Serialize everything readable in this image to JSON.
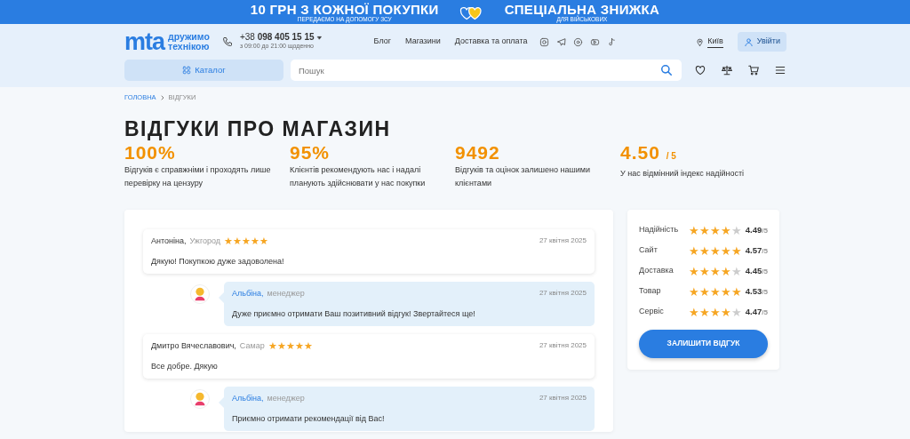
{
  "promo_banner": {
    "left_title": "10 ГРН З КОЖНОЇ ПОКУПКИ",
    "left_subtitle": "ПЕРЕДАЄМО НА ДОПОМОГУ ЗСУ",
    "right_title": "СПЕЦІАЛЬНА ЗНИЖКА",
    "right_subtitle": "ДЛЯ ВІЙСЬКОВИХ"
  },
  "header": {
    "logo": {
      "mark": "mta",
      "tagline": [
        "дружимо",
        "технікою"
      ]
    },
    "phone": {
      "prefix": "+38",
      "number": "098 405 15 15",
      "hours": "з 09:00 до 21:00 щоденно"
    },
    "nav_links": [
      "Блог",
      "Магазини",
      "Доставка та оплата"
    ],
    "city": "Київ",
    "login_button": "Увійти",
    "catalog_button": "Каталог",
    "search": {
      "placeholder": "Пошук"
    }
  },
  "breadcrumbs": [
    "ГОЛОВНА",
    "ВІДГУКИ"
  ],
  "page_title": "ВІДГУКИ ПРО МАГАЗИН",
  "stats": [
    {
      "value": "100%",
      "description": "Відгуків є справжніми і проходять лише перевірку на цензуру"
    },
    {
      "value": "95%",
      "description": "Клієнтів рекомендують нас і надалі планують здійснювати у нас покупки"
    },
    {
      "value": "9492",
      "description": "Відгуків та оцінок залишено нашими клієнтами"
    },
    {
      "value": "4.50",
      "suffix": "/ 5",
      "description": "У нас відмінний індекс надійності"
    }
  ],
  "reviews": [
    {
      "kind": "customer",
      "author": "Антоніна,",
      "city": "Ужгород",
      "stars": 5,
      "date": "27 квітня 2025",
      "text": "Дякую! Покупкою дуже задоволена!"
    },
    {
      "kind": "reply",
      "author": "Альбіна,",
      "role": "менеджер",
      "date": "27 квітня 2025",
      "text": "Дуже приємно отримати Ваш позитивний відгук! Звертайтеся ще!"
    },
    {
      "kind": "customer",
      "author": "Дмитро Вячеславович,",
      "city": "Самар",
      "stars": 5,
      "date": "27 квітня 2025",
      "text": "Все добре. Дякую"
    },
    {
      "kind": "reply",
      "author": "Альбіна,",
      "role": "менеджер",
      "date": "27 квітня 2025",
      "text": "Приємно отримати рекомендації від Вас!"
    }
  ],
  "ratings": [
    {
      "label": "Надійність",
      "stars": 4,
      "value": "4.49",
      "out_of": "/5"
    },
    {
      "label": "Сайт",
      "stars": 5,
      "value": "4.57",
      "out_of": "/5"
    },
    {
      "label": "Доставка",
      "stars": 4,
      "value": "4.45",
      "out_of": "/5"
    },
    {
      "label": "Товар",
      "stars": 5,
      "value": "4.53",
      "out_of": "/5"
    },
    {
      "label": "Сервіс",
      "stars": 4,
      "value": "4.47",
      "out_of": "/5"
    }
  ],
  "leave_review_button": "ЗАЛИШИТИ ВІДГУК"
}
